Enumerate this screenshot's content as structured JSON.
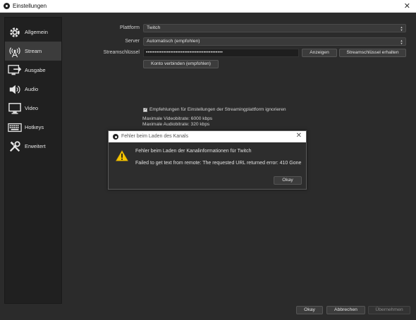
{
  "window": {
    "title": "Einstellungen",
    "close_glyph": "✕"
  },
  "sidebar": {
    "items": [
      {
        "label": "Allgemein",
        "icon": "gear-icon"
      },
      {
        "label": "Stream",
        "icon": "broadcast-icon"
      },
      {
        "label": "Ausgabe",
        "icon": "output-icon"
      },
      {
        "label": "Audio",
        "icon": "speaker-icon"
      },
      {
        "label": "Video",
        "icon": "monitor-icon"
      },
      {
        "label": "Hotkeys",
        "icon": "keyboard-icon"
      },
      {
        "label": "Erweitert",
        "icon": "tools-icon"
      }
    ],
    "active_index": 1
  },
  "stream": {
    "platform_label": "Plattform",
    "platform_value": "Twitch",
    "server_label": "Server",
    "server_value": "Automatisch (empfohlen)",
    "key_label": "Streamschlüssel",
    "key_value": "••••••••••••••••••••••••••••••••••••••••••••",
    "show_button": "Anzeigen",
    "get_key_button": "Streamschlüssel erhalten",
    "connect_button": "Konto verbinden (empfohlen)",
    "ignore_checkbox_label": "Empfehlungen für Einstellungen der Streamingplattform ignorieren",
    "ignore_checked": true,
    "max_video_bitrate": "Maximale Videobitrate: 6000 kbps",
    "max_audio_bitrate": "Maximale Audiobitrate: 320 kbps"
  },
  "dialog": {
    "title": "Fehler beim Laden des Kanals",
    "close_glyph": "✕",
    "message_title": "Fehler beim Laden der Kanalinformationen für Twitch",
    "message_detail": "Failed to get text from remote: The requested URL returned error: 410 Gone",
    "ok_button": "Okay"
  },
  "footer": {
    "ok_button": "Okay",
    "cancel_button": "Abbrechen",
    "apply_button": "Übernehmen"
  },
  "colors": {
    "background": "#2b2b2b",
    "sidebar": "#202020",
    "active_item": "#3c3c3c",
    "warning": "#f5c400"
  }
}
